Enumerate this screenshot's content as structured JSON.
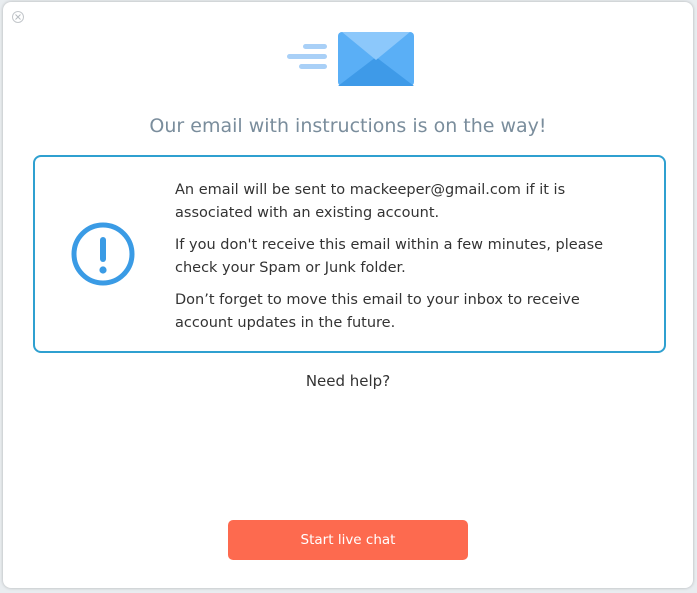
{
  "dialog": {
    "title": "Our email with instructions is on the way!",
    "messages": [
      "An email will be sent to mackeeper@gmail.com if it is associated with an existing account.",
      "If you don't receive this email within a few minutes, please check your Spam or Junk folder.",
      "Don’t forget to move this email to your inbox to receive account updates in the future."
    ],
    "help_text": "Need help?",
    "chat_button_label": "Start live chat"
  },
  "icons": {
    "close": "close-icon",
    "hero": "envelope-icon",
    "alert": "exclamation-circle-icon"
  },
  "colors": {
    "title": "#7a8d9c",
    "box_border": "#2fa0d0",
    "alert_icon": "#3a9be5",
    "envelope": "#5aaff6",
    "button": "#fd6a4f"
  }
}
